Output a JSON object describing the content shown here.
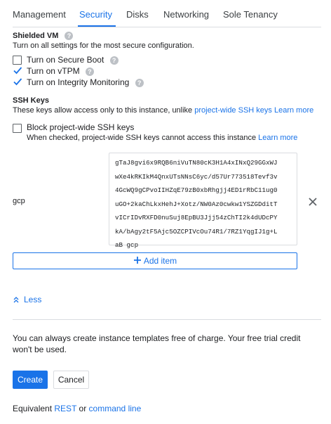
{
  "tabs": [
    {
      "label": "Management"
    },
    {
      "label": "Security"
    },
    {
      "label": "Disks"
    },
    {
      "label": "Networking"
    },
    {
      "label": "Sole Tenancy"
    }
  ],
  "active_tab": "Security",
  "shielded_vm": {
    "title": "Shielded VM",
    "description": "Turn on all settings for the most secure configuration.",
    "options": [
      {
        "label": "Turn on Secure Boot",
        "checked": false
      },
      {
        "label": "Turn on vTPM",
        "checked": true
      },
      {
        "label": "Turn on Integrity Monitoring",
        "checked": true
      }
    ]
  },
  "ssh_keys": {
    "title": "SSH Keys",
    "description_prefix": "These keys allow access only to this instance, unlike ",
    "project_link": "project-wide SSH keys",
    "learn_more": "Learn more",
    "block_label": "Block project-wide SSH keys",
    "block_checked": false,
    "block_description": "When checked, project-wide SSH keys cannot access this instance",
    "block_learn_more": "Learn more",
    "key_username": "gcp",
    "key_lines": [
      "gTaJ8gvi6x9RQB6niVuTN80cK3H1A4xINxQ29GGxWJ",
      "wXe4kRKIkM4QnxUTsNNsC6yc/d57Ur773518Tevf3v",
      "4GcWQ9gCPvoIIHZqE79zB0xbRhgjj4ED1rRbC11ug0",
      "uGO+2kaChLkxHehJ+Xotz/NW0Az0cwkw1YSZGDditT",
      "vICrIDvRXFD0nuSuj8EpBU3Jjj54zChTI2k4dUDcPY",
      "kA/bAgy2tF5Ajc5OZCPIVcOu74R1/7RZ1YqgIJ1g+L",
      "aB gcp"
    ],
    "remove_icon": "close-icon",
    "add_item_label": "Add item"
  },
  "less_label": "Less",
  "footer_note": {
    "line1": "You can always create instance templates free of charge. Your free trial credit",
    "line2": "won't be used."
  },
  "buttons": {
    "create": "Create",
    "cancel": "Cancel"
  },
  "equivalent": {
    "prefix": "Equivalent",
    "rest": "REST",
    "or": "or",
    "command_line": "command line"
  },
  "colors": {
    "accent": "#1a73e8",
    "text": "#202124",
    "border": "#dadce0"
  }
}
